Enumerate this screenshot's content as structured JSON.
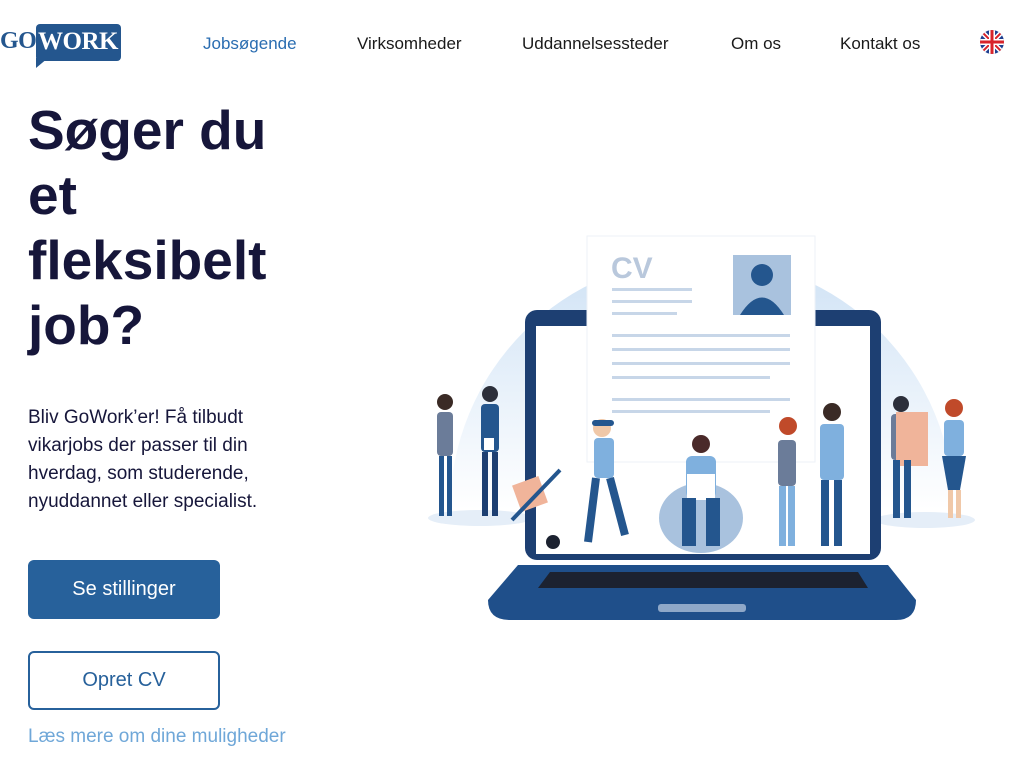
{
  "logo": {
    "part1": "GO",
    "part2": "WORK"
  },
  "nav": {
    "items": [
      {
        "label": "Jobsøgende",
        "active": true
      },
      {
        "label": "Virksomheder",
        "active": false
      },
      {
        "label": "Uddannelsessteder",
        "active": false
      },
      {
        "label": "Om os",
        "active": false
      },
      {
        "label": "Kontakt os",
        "active": false
      }
    ],
    "language_icon": "uk-flag-icon"
  },
  "hero": {
    "title_lines": [
      "Søger du",
      "et",
      "fleksibelt",
      "job?"
    ],
    "description": "Bliv GoWork’er! Få tilbudt vikarjobs der passer til din hverdag, som studerende, nyuddannet eller specialist.",
    "primary_button": "Se stillinger",
    "secondary_button": "Opret CV",
    "link": "Læs mere om dine muligheder"
  },
  "illustration": {
    "cv_label": "CV"
  },
  "colors": {
    "brand": "#24568e",
    "button": "#27619b",
    "nav_active": "#2a6db1",
    "link": "#6fa7d8",
    "heading": "#16163a"
  }
}
